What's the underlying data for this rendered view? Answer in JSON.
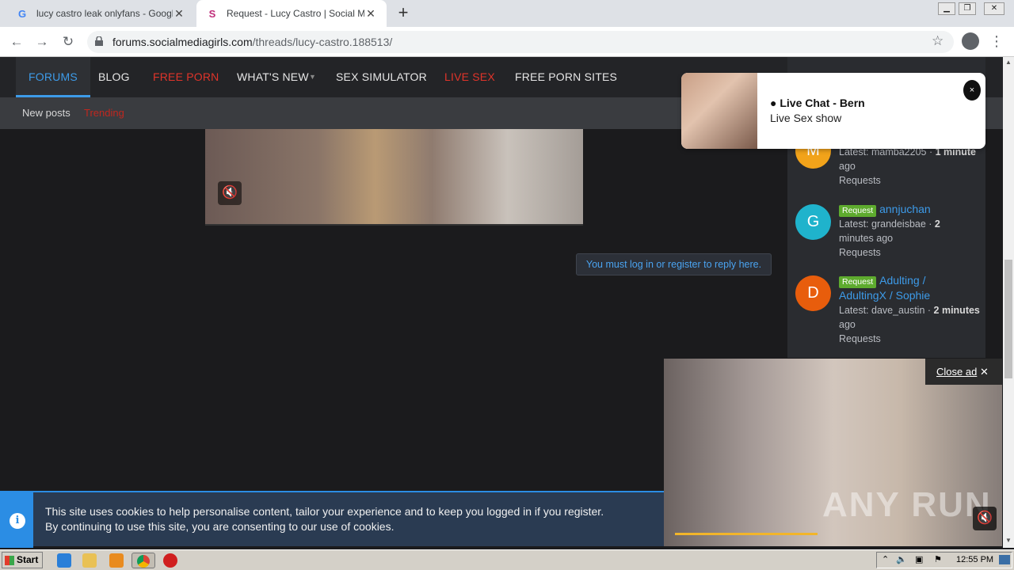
{
  "browser": {
    "tabs": [
      {
        "title": "lucy castro leak onlyfans - Google Se",
        "favicon": "G"
      },
      {
        "title": "Request - Lucy Castro | Social Media",
        "favicon": "S"
      }
    ],
    "url_host": "forums.socialmediagirls.com",
    "url_path": "/threads/lucy-castro.188513/"
  },
  "nav": {
    "forums": "FORUMS",
    "blog": "BLOG",
    "free_porn": "FREE PORN",
    "whats_new": "WHAT'S NEW",
    "sex_simulator": "SEX SIMULATOR",
    "live_sex": "LIVE SEX",
    "free_porn_sites": "FREE PORN SITES"
  },
  "subnav": {
    "new_posts": "New posts",
    "trending": "Trending"
  },
  "reply_prompt": "You must log in or register to reply here.",
  "notification": {
    "title": "Live Chat - Bern",
    "subtitle": "Live Sex show",
    "close": "×"
  },
  "sidebar": {
    "threads": [
      {
        "avatar": "M",
        "avatar_color": "#f2a31a",
        "latest": "Latest: mamba2205 · ",
        "time": "1 minute",
        "time_rest": "ago",
        "forum": "Requests"
      },
      {
        "avatar": "G",
        "avatar_color": "#1fb3cc",
        "badge": "Request",
        "title": "annjuchan",
        "latest": "Latest: grandeisbae · ",
        "time": "2",
        "time_rest": "minutes ago",
        "forum": "Requests"
      },
      {
        "avatar": "D",
        "avatar_color": "#e85d0c",
        "badge": "Request",
        "title": "Adulting /",
        "title2": "AdultingX / Sophie",
        "latest": "Latest: dave_austin · ",
        "time": "2 minutes",
        "time_rest": "ago",
        "forum": "Requests"
      }
    ]
  },
  "ad": {
    "close_label": "Close ad",
    "close_icon": "✕",
    "watermark": "ANY RUN"
  },
  "cookie": {
    "line1": "This site uses cookies to help personalise content, tailor your experience and to keep you logged in if you register.",
    "line2": "By continuing to use this site, you are consenting to our use of cookies."
  },
  "taskbar": {
    "start": "Start",
    "clock": "12:55 PM"
  },
  "colors": {
    "accent": "#3d9be9",
    "red": "#e0342a",
    "badge_green": "#5eab2e"
  }
}
